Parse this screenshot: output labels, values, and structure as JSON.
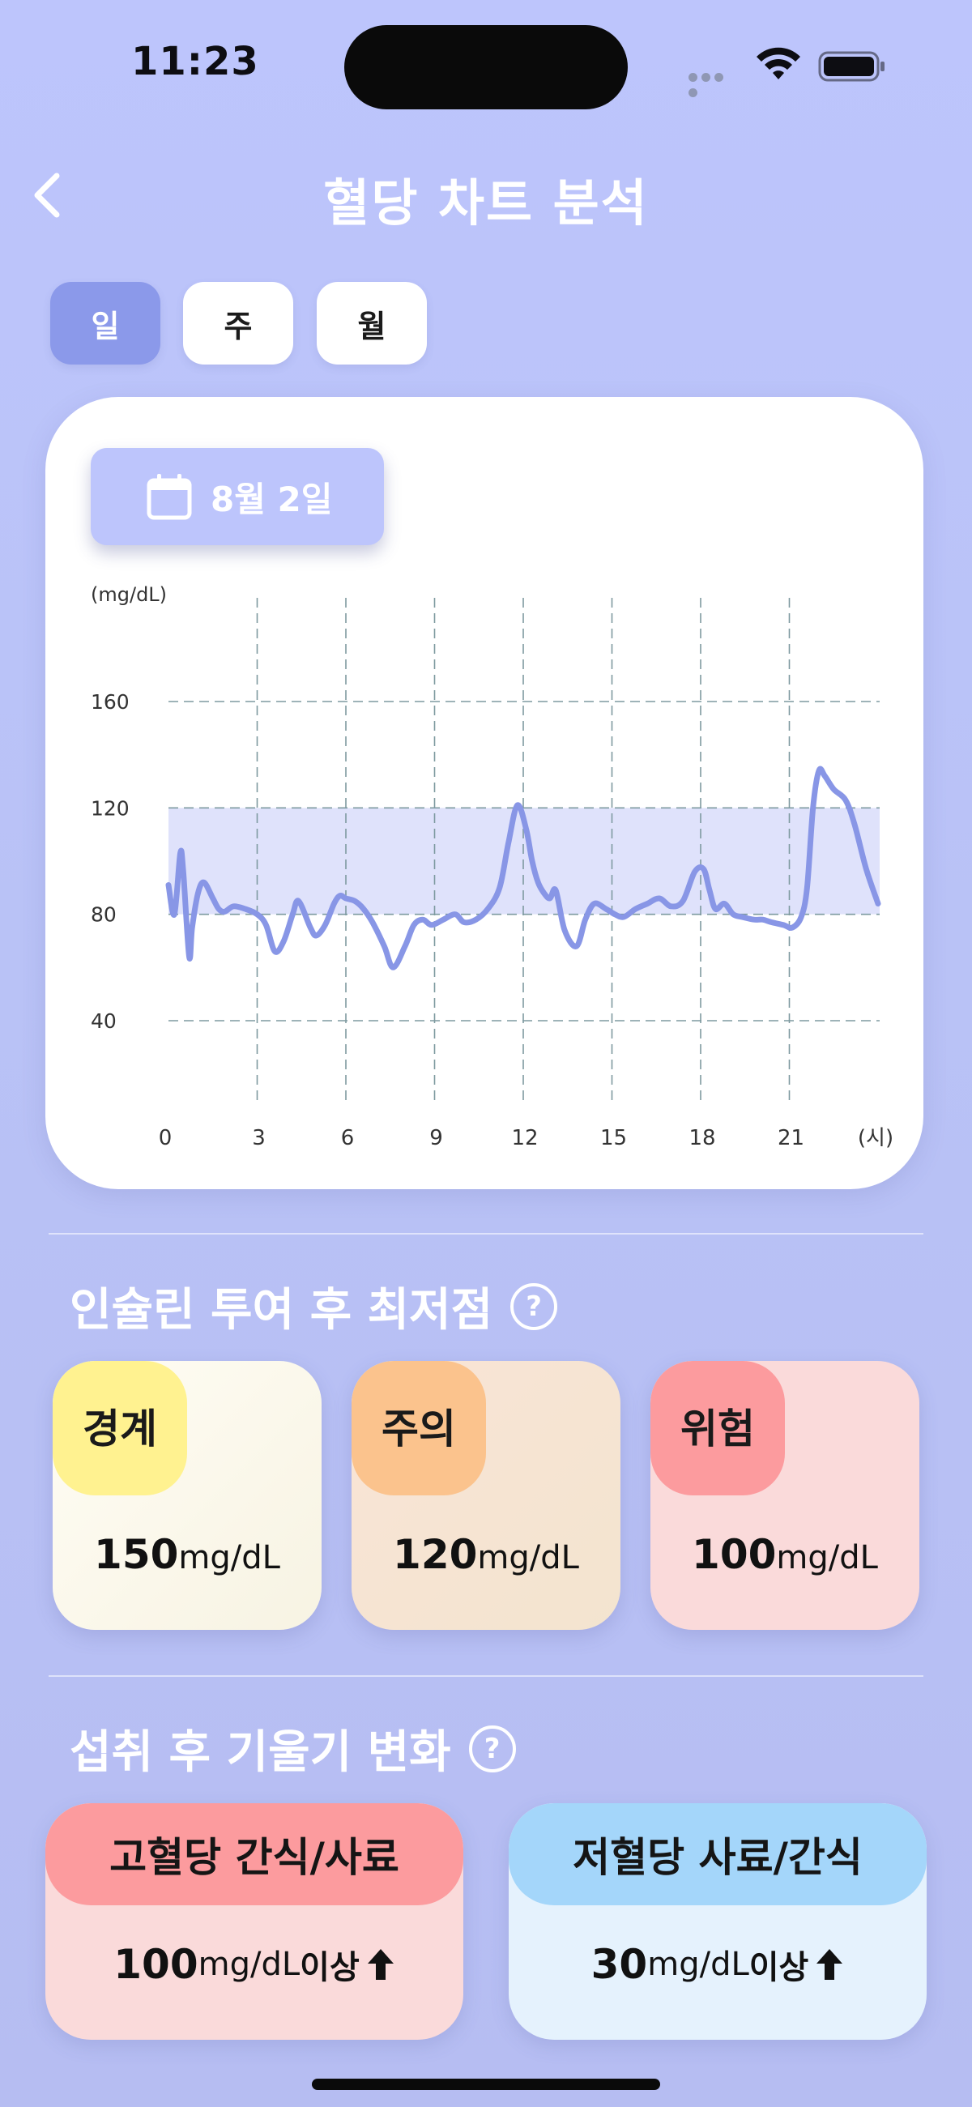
{
  "status_bar": {
    "time": "11:23"
  },
  "header": {
    "title": "혈당 차트 분석"
  },
  "tabs": [
    {
      "label": "일",
      "active": true
    },
    {
      "label": "주",
      "active": false
    },
    {
      "label": "월",
      "active": false
    }
  ],
  "date_chip": {
    "label": "8월 2일",
    "icon": "calendar-icon"
  },
  "chart_data": {
    "type": "line",
    "ylabel": "(mg/dL)",
    "xlabel": "(시)",
    "y_ticks": [
      160,
      120,
      80,
      40
    ],
    "x_ticks": [
      0,
      3,
      6,
      9,
      12,
      15,
      18,
      21
    ],
    "xlim": [
      0,
      24
    ],
    "ylim": [
      20,
      180
    ],
    "target_band": [
      80,
      120
    ],
    "grid": true,
    "series": [
      {
        "x": [
          0,
          0.2,
          0.4,
          0.5,
          0.7,
          0.8,
          1.0,
          1.2,
          1.5,
          1.7,
          1.9,
          2.2,
          2.6,
          3.0,
          3.3,
          3.6,
          3.9,
          4.2,
          4.4,
          4.8,
          5.0,
          5.3,
          5.6,
          5.8,
          6.0,
          6.3,
          6.6,
          6.9,
          7.3,
          7.6,
          8.0,
          8.3,
          8.6,
          8.9,
          9.3,
          9.7,
          10.0,
          10.4,
          10.8,
          11.2,
          11.5,
          11.8,
          12.1,
          12.3,
          12.5,
          12.7,
          12.9,
          13.1,
          13.4,
          13.8,
          14.1,
          14.4,
          14.8,
          15.1,
          15.4,
          15.8,
          16.2,
          16.6,
          17.0,
          17.4,
          17.8,
          18.1,
          18.3,
          18.5,
          18.8,
          19.1,
          19.4,
          19.8,
          20.1,
          20.4,
          20.8,
          21.1,
          21.4,
          21.6,
          21.8,
          22.0,
          22.2,
          22.5,
          22.9,
          23.2,
          23.6,
          24.0
        ],
        "values": [
          91,
          80,
          103,
          96,
          64,
          75,
          88,
          92,
          86,
          82,
          81,
          83,
          82,
          80,
          76,
          66,
          70,
          80,
          85,
          75,
          72,
          76,
          84,
          87,
          86,
          85,
          82,
          77,
          68,
          60,
          68,
          76,
          78,
          76,
          78,
          80,
          77,
          78,
          82,
          90,
          107,
          121,
          112,
          100,
          92,
          88,
          86,
          89,
          74,
          68,
          78,
          84,
          82,
          80,
          79,
          82,
          84,
          86,
          83,
          85,
          96,
          97,
          89,
          82,
          84,
          80,
          79,
          78,
          78,
          77,
          76,
          75,
          79,
          90,
          120,
          134,
          132,
          127,
          123,
          114,
          97,
          84
        ]
      }
    ]
  },
  "insulin_section": {
    "title": "인슐린 투여 후 최저점",
    "help": "?",
    "cards": [
      {
        "tag": "경계",
        "value": "150",
        "unit": "mg/dL",
        "tag_color": "#fff290",
        "bg": "#fdfbee"
      },
      {
        "tag": "주의",
        "value": "120",
        "unit": "mg/dL",
        "tag_color": "#fbc38d",
        "bg": "#f7e5d2"
      },
      {
        "tag": "위험",
        "value": "100",
        "unit": "mg/dL",
        "tag_color": "#fc9b9e",
        "bg": "#fadada"
      }
    ]
  },
  "slope_section": {
    "title": "섭취 후 기울기 변화",
    "help": "?",
    "cards": [
      {
        "title": "고혈당 간식/사료",
        "value": "100",
        "unit": "mg/dL",
        "suffix": "이상",
        "head_color": "#fc9b9e",
        "bg": "#fadada"
      },
      {
        "title": "저혈당 사료/간식",
        "value": "30",
        "unit": "mg/dL",
        "suffix": "이상",
        "head_color": "#a4d6fa",
        "bg": "#e5f2fd"
      }
    ]
  }
}
